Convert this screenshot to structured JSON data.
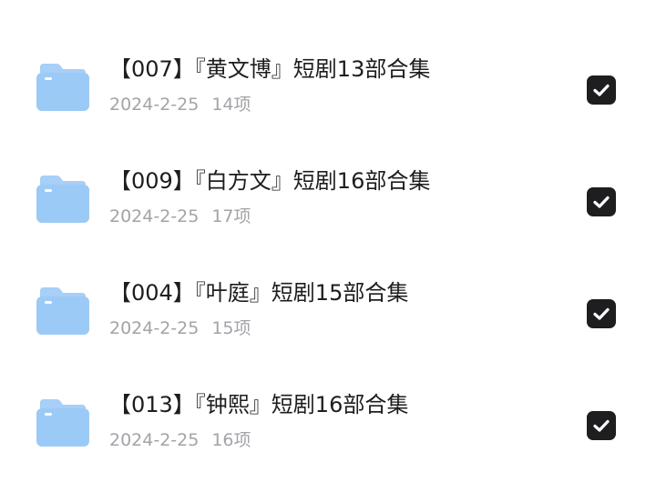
{
  "items": [
    {
      "title": "【007】『黄文博』短剧13部合集",
      "date": "2024-2-25",
      "count": "14项",
      "checked": true
    },
    {
      "title": "【009】『白方文』短剧16部合集",
      "date": "2024-2-25",
      "count": "17项",
      "checked": true
    },
    {
      "title": "【004】『叶庭』短剧15部合集",
      "date": "2024-2-25",
      "count": "15项",
      "checked": true
    },
    {
      "title": "【013】『钟熙』短剧16部合集",
      "date": "2024-2-25",
      "count": "16项",
      "checked": true
    }
  ],
  "colors": {
    "folder_light": "#bcdcfb",
    "folder_dark": "#8fc3f5",
    "title": "#1d1d1f",
    "meta": "#a3a3a8",
    "checkbox": "#1e1e20"
  },
  "icons": {
    "folder": "folder-icon",
    "check": "checkmark-icon"
  }
}
